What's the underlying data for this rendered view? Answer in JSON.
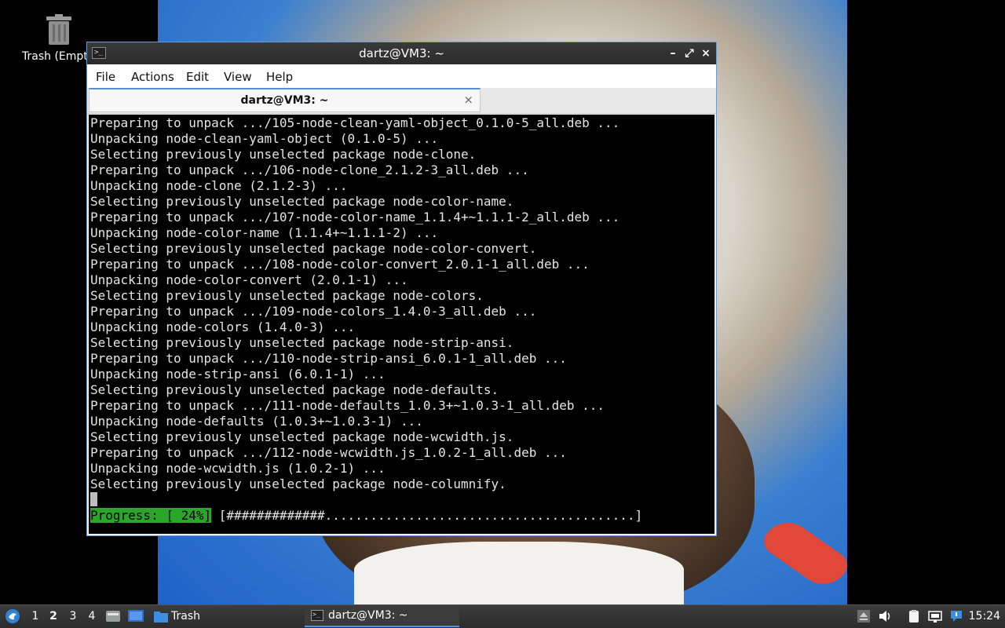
{
  "desktop": {
    "trash_label": "Trash (Empt"
  },
  "window": {
    "title": "dartz@VM3: ~",
    "menu": [
      "File",
      "Actions",
      "Edit",
      "View",
      "Help"
    ],
    "tab_title": "dartz@VM3: ~",
    "tab_close": "×",
    "minimize": "–",
    "maximize": "⤢",
    "close": "×"
  },
  "terminal": {
    "lines": [
      "Preparing to unpack .../105-node-clean-yaml-object_0.1.0-5_all.deb ...",
      "Unpacking node-clean-yaml-object (0.1.0-5) ...",
      "Selecting previously unselected package node-clone.",
      "Preparing to unpack .../106-node-clone_2.1.2-3_all.deb ...",
      "Unpacking node-clone (2.1.2-3) ...",
      "Selecting previously unselected package node-color-name.",
      "Preparing to unpack .../107-node-color-name_1.1.4+~1.1.1-2_all.deb ...",
      "Unpacking node-color-name (1.1.4+~1.1.1-2) ...",
      "Selecting previously unselected package node-color-convert.",
      "Preparing to unpack .../108-node-color-convert_2.0.1-1_all.deb ...",
      "Unpacking node-color-convert (2.0.1-1) ...",
      "Selecting previously unselected package node-colors.",
      "Preparing to unpack .../109-node-colors_1.4.0-3_all.deb ...",
      "Unpacking node-colors (1.4.0-3) ...",
      "Selecting previously unselected package node-strip-ansi.",
      "Preparing to unpack .../110-node-strip-ansi_6.0.1-1_all.deb ...",
      "Unpacking node-strip-ansi (6.0.1-1) ...",
      "Selecting previously unselected package node-defaults.",
      "Preparing to unpack .../111-node-defaults_1.0.3+~1.0.3-1_all.deb ...",
      "Unpacking node-defaults (1.0.3+~1.0.3-1) ...",
      "Selecting previously unselected package node-wcwidth.js.",
      "Preparing to unpack .../112-node-wcwidth.js_1.0.2-1_all.deb ...",
      "Unpacking node-wcwidth.js (1.0.2-1) ...",
      "Selecting previously unselected package node-columnify."
    ],
    "progress_label": "Progress: [ 24%]",
    "progress_bar": " [#############.........................................]",
    "progress_percent": 24
  },
  "taskbar": {
    "workspaces": [
      "1",
      "2",
      "3",
      "4"
    ],
    "active_workspace": "2",
    "trash_label": "Trash",
    "task_label": "dartz@VM3: ~",
    "clock": "15:24"
  },
  "colors": {
    "progress_green": "#2ba52b",
    "accent_blue": "#5b8fd6"
  }
}
